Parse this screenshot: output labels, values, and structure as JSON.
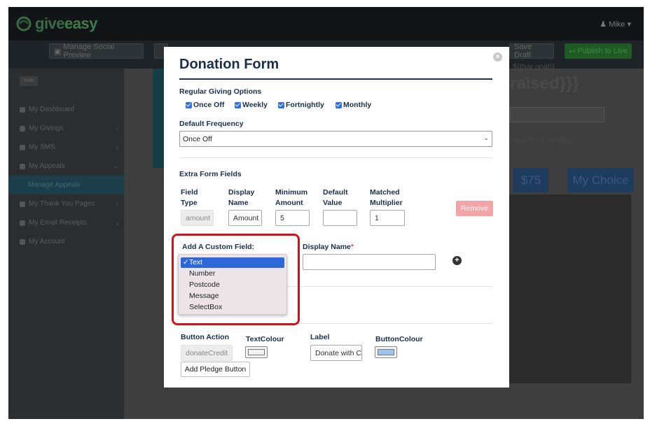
{
  "app": {
    "logo_text_a": "give",
    "logo_text_b": "easy",
    "user_name": "Mike",
    "brand_color": "#3f7c4b",
    "accent_blue": "#2d68d8"
  },
  "actionbar": {
    "manage_social_preview": "Manage Social Preview",
    "save_draft": "Save Draft",
    "publish_to_live": "Publish to Live"
  },
  "sidebar": {
    "hide_label": "Hide",
    "items": [
      {
        "label": "My Dashboard"
      },
      {
        "label": "My Givings"
      },
      {
        "label": "My SMS"
      },
      {
        "label": "My Appeals"
      },
      {
        "label": "Manage Appeals"
      },
      {
        "label": "My Thank You Pages"
      },
      {
        "label": "My Email Receipts"
      },
      {
        "label": "My Account"
      }
    ]
  },
  "background": {
    "bar_goal_tpl": "${{bar.goal}}",
    "raised_tpl": "raised}}}",
    "percent_tpl": "cent}}}% of our goal.",
    "amount_75": "$75",
    "my_choice": "My Choice"
  },
  "modal": {
    "title": "Donation Form",
    "regular_giving_label": "Regular Giving Options",
    "giving_options": [
      {
        "label": "Once Off",
        "checked": true
      },
      {
        "label": "Weekly",
        "checked": true
      },
      {
        "label": "Fortnightly",
        "checked": true
      },
      {
        "label": "Monthly",
        "checked": true
      }
    ],
    "default_frequency_label": "Default Frequency",
    "default_frequency_value": "Once Off",
    "extra_fields_label": "Extra Form Fields",
    "columns": {
      "field_type": "Field\nType",
      "display_name": "Display\nName",
      "minimum_amount": "Minimum\nAmount",
      "default_value": "Default\nValue",
      "matched_multiplier": "Matched\nMultiplier"
    },
    "field_row": {
      "field_type": "amount",
      "display_name": "Amount",
      "minimum_amount": "5",
      "default_value": "",
      "matched_multiplier": "1"
    },
    "remove_label": "Remove",
    "custom_field_label": "Add A Custom Field:",
    "display_name_label": "Display Name",
    "required_mark": "*",
    "custom_field_options": [
      "Text",
      "Number",
      "Postcode",
      "Message",
      "SelectBox"
    ],
    "custom_field_selected": "Text",
    "button_action_label": "Button Action",
    "button_action_value": "donateCredit",
    "text_colour_label": "TextColour",
    "label_label": "Label",
    "label_value": "Donate with C",
    "button_colour_label": "ButtonColour",
    "text_colour_value": "#f3f3f3",
    "button_colour_value": "#9ec4ee",
    "add_pledge_button": "Add Pledge Button"
  }
}
